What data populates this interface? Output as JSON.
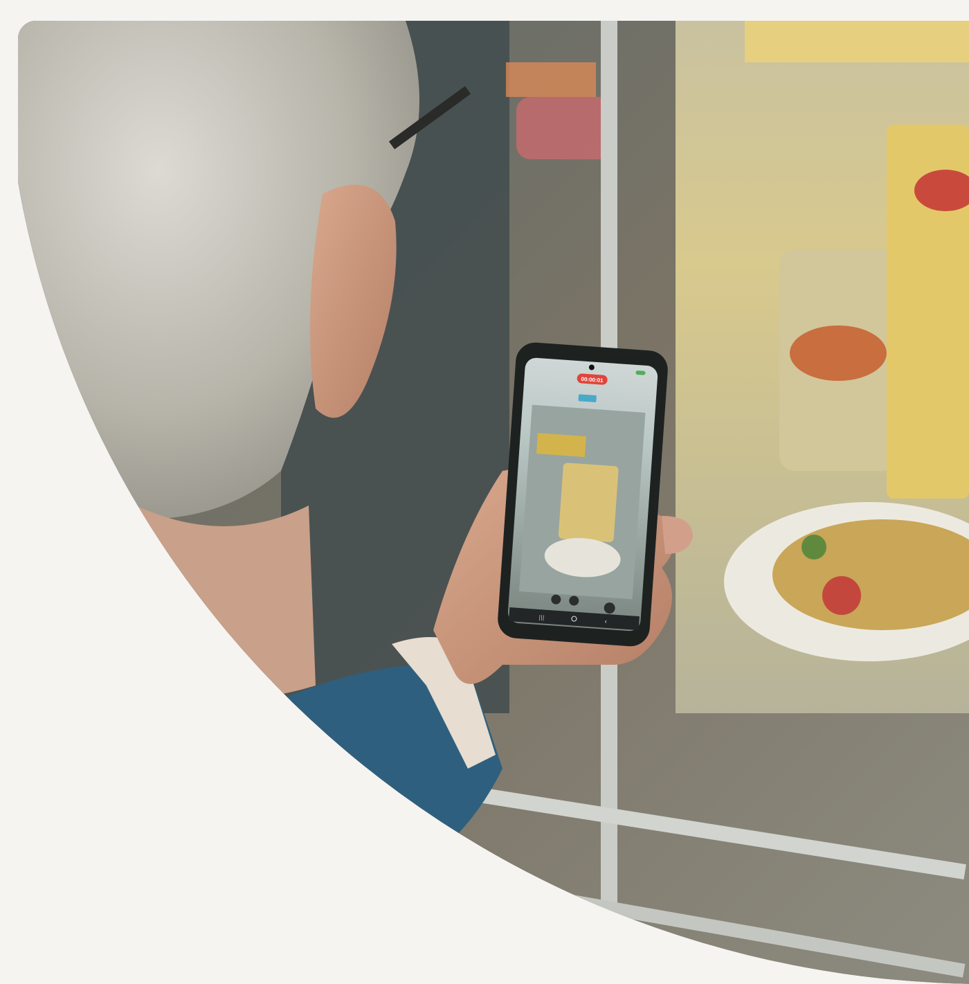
{
  "scene": {
    "subject": "person-photographing-poster-with-phone",
    "phone_screen": {
      "timer": "00:00:01"
    },
    "colors": {
      "background": "#f5f4f1",
      "recording_badge": "#e0443b",
      "poster_yellow": "#e8d28a",
      "sweater_blue": "#2f5f7e"
    }
  }
}
